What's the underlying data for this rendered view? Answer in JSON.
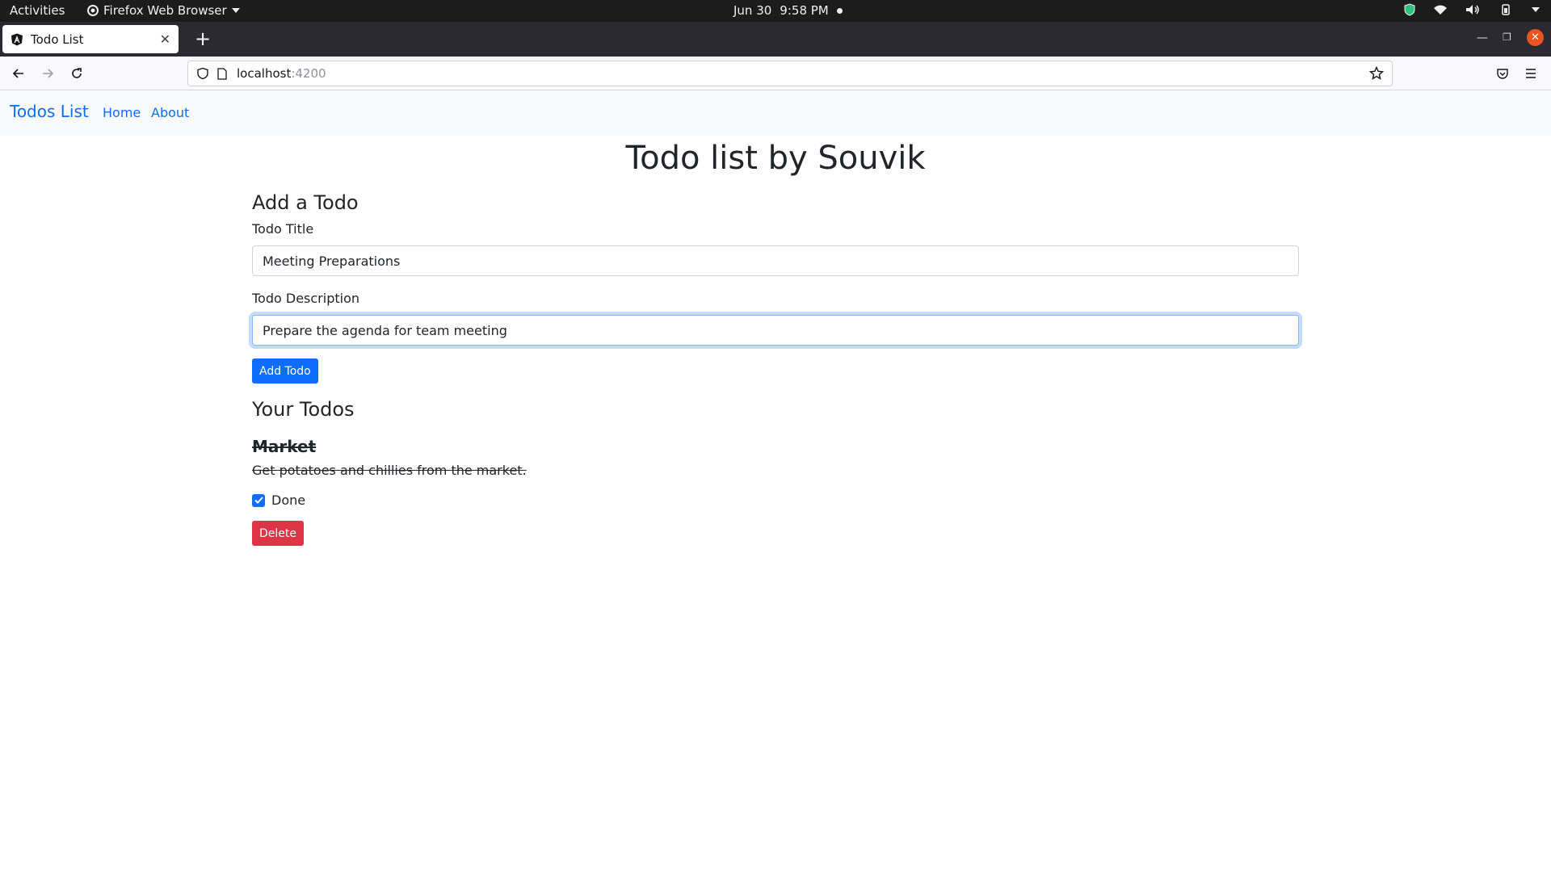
{
  "system_bar": {
    "activities": "Activities",
    "app_name": "Firefox Web Browser",
    "date": "Jun 30",
    "time": "9:58 PM"
  },
  "browser": {
    "tab_title": "Todo List",
    "url_host": "localhost",
    "url_port": ":4200"
  },
  "app_nav": {
    "brand": "Todos List",
    "links": [
      "Home",
      "About"
    ]
  },
  "page": {
    "title": "Todo list by Souvik",
    "add_heading": "Add a Todo",
    "title_label": "Todo Title",
    "title_value": "Meeting Preparations",
    "desc_label": "Todo Description",
    "desc_value": "Prepare the agenda for team meeting",
    "add_button": "Add Todo",
    "list_heading": "Your Todos",
    "todos": [
      {
        "title": "Market",
        "description": "Get potatoes and chillies from the market.",
        "done_label": "Done",
        "done": true,
        "delete_label": "Delete"
      }
    ]
  },
  "colors": {
    "primary": "#0d6efd",
    "danger": "#dc3545",
    "ubuntu_orange": "#e95420"
  }
}
